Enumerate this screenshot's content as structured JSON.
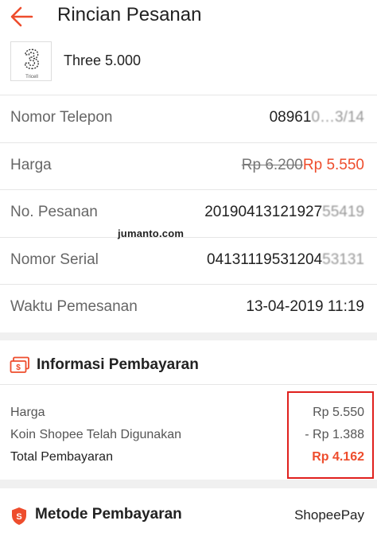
{
  "header": {
    "title": "Rincian Pesanan",
    "back_icon": "arrow-left-icon",
    "accent": "#ee4d2d"
  },
  "product": {
    "name": "Three 5.000",
    "logo_caption": "Tricell"
  },
  "details": [
    {
      "label": "Nomor Telepon",
      "value": "08961",
      "value_obscured": "0…3/14"
    },
    {
      "label": "Harga",
      "old_price": "Rp 6.200",
      "price": "Rp 5.550"
    },
    {
      "label": "No. Pesanan",
      "value": "20190413121927",
      "value_obscured": "55419"
    },
    {
      "label": "Nomor Serial",
      "value": "04131119531204",
      "value_obscured": "53131"
    },
    {
      "label": "Waktu Pemesanan",
      "value": "13-04-2019 11:19"
    }
  ],
  "watermark": "jumanto.com",
  "payment_info": {
    "title": "Informasi Pembayaran",
    "icon": "payment-card-icon",
    "lines": [
      {
        "label": "Harga",
        "value": "Rp 5.550"
      },
      {
        "label": "Koin Shopee Telah Digunakan",
        "value": "- Rp 1.388"
      }
    ],
    "total": {
      "label": "Total Pembayaran",
      "value": "Rp 4.162"
    },
    "highlight_color": "#e0201d"
  },
  "payment_method": {
    "title": "Metode Pembayaran",
    "icon": "shopee-shield-icon",
    "value": "ShopeePay"
  }
}
